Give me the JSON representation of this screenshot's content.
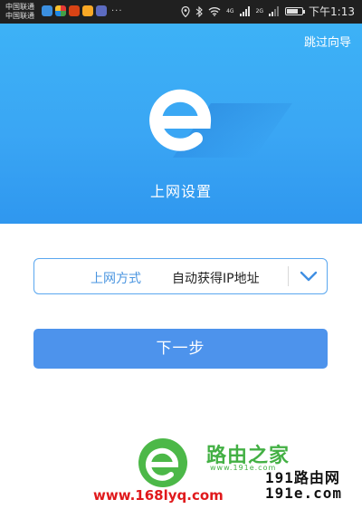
{
  "status_bar": {
    "carrier_1": "中国联通",
    "carrier_2": "中国联通",
    "more_indicator": "···",
    "time": "下午1:13",
    "battery_level": 0.8,
    "network_1": "4G",
    "network_2": "2G"
  },
  "header": {
    "skip_label": "跳过向导",
    "title": "上网设置",
    "logo_icon": "e-logo-icon",
    "background_color": "#3aa6f4"
  },
  "form": {
    "connection_label": "上网方式",
    "connection_value": "自动获得IP地址",
    "dropdown_icon": "chevron-down-icon"
  },
  "actions": {
    "next_label": "下一步",
    "button_color": "#4d93ec"
  },
  "watermark": {
    "brand_name": "路由之家",
    "brand_site": "www.191e.com",
    "url": "www.168lyq.com",
    "line_1": "191路由网",
    "line_2": "191e.com"
  }
}
